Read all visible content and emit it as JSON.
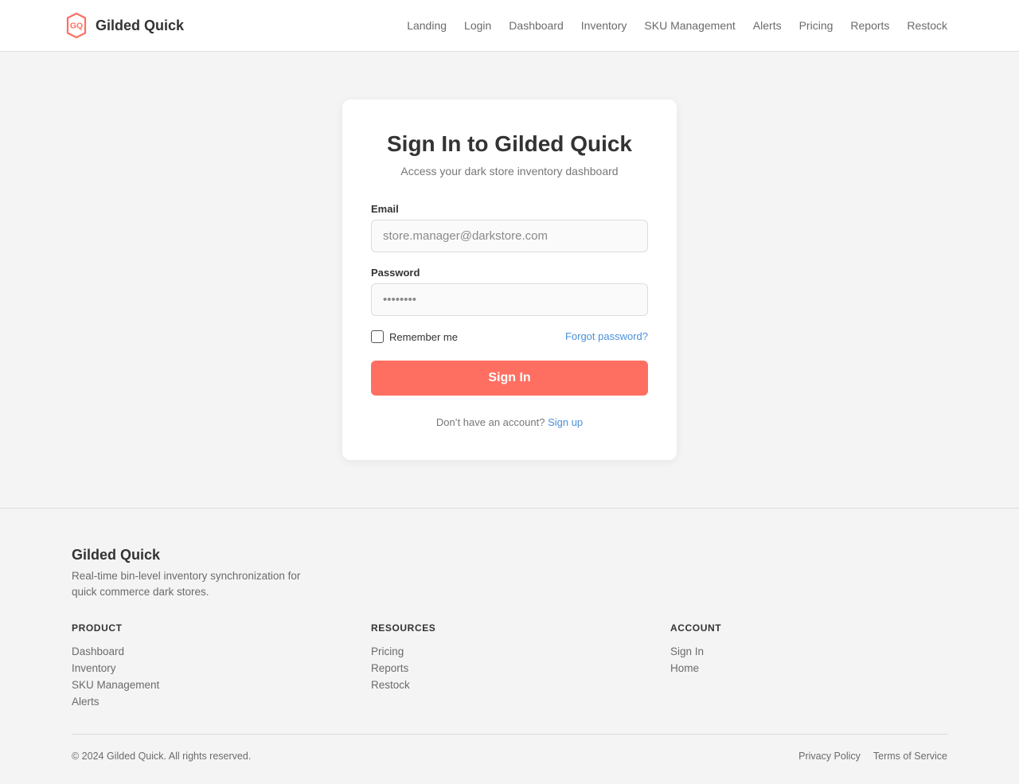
{
  "header": {
    "logo_text": "GQ",
    "brand_name": "Gilded Quick",
    "nav": [
      "Landing",
      "Login",
      "Dashboard",
      "Inventory",
      "SKU Management",
      "Alerts",
      "Pricing",
      "Reports",
      "Restock"
    ]
  },
  "login": {
    "title": "Sign In to Gilded Quick",
    "subtitle": "Access your dark store inventory dashboard",
    "email_label": "Email",
    "email_placeholder": "store.manager@darkstore.com",
    "password_label": "Password",
    "password_placeholder": "••••••••",
    "remember_label": "Remember me",
    "remember_checked": false,
    "forgot_label": "Forgot password?",
    "submit_label": "Sign In",
    "signup_prompt": "Don’t have an account?",
    "signup_link": "Sign up"
  },
  "footer": {
    "brand": "Gilded Quick",
    "tagline": "Real-time bin-level inventory synchronization for quick commerce dark stores.",
    "columns": [
      {
        "title": "PRODUCT",
        "links": [
          "Dashboard",
          "Inventory",
          "SKU Management",
          "Alerts"
        ]
      },
      {
        "title": "RESOURCES",
        "links": [
          "Pricing",
          "Reports",
          "Restock"
        ]
      },
      {
        "title": "ACCOUNT",
        "links": [
          "Sign In",
          "Home"
        ]
      }
    ],
    "copyright": "© 2024 Gilded Quick. All rights reserved.",
    "legal": [
      "Privacy Policy",
      "Terms of Service"
    ]
  },
  "colors": {
    "accent": "#ff6f61",
    "link": "#4a90d9",
    "background": "#f4f4f4"
  },
  "icons": {
    "logo": "hexagon-shield-logo-icon"
  }
}
